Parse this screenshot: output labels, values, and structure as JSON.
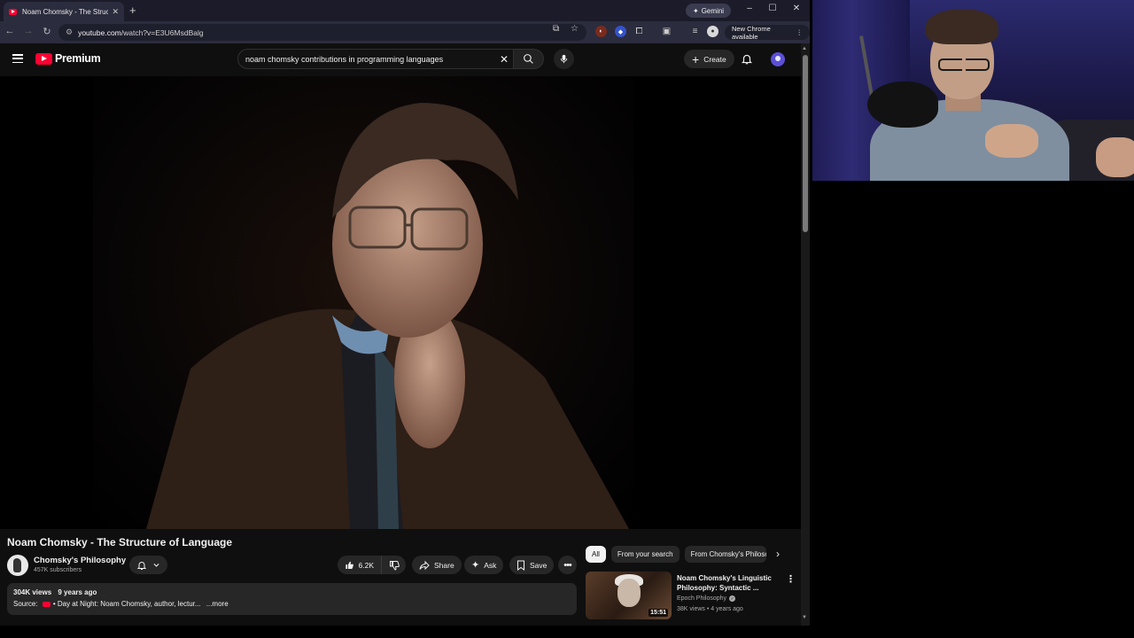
{
  "browser": {
    "tab": {
      "title": "Noam Chomsky - The Structure",
      "close": "✕"
    },
    "new_tab": "+",
    "gemini_label": "Gemini",
    "gemini_glyph": "✦",
    "window": {
      "minimize": "–",
      "maximize": "☐",
      "close": "✕"
    },
    "address": {
      "host": "youtube.com",
      "path": "/watch?v=E3U6MsdBalg"
    },
    "new_chrome_label": "New Chrome available",
    "kebab": "⋮"
  },
  "youtube": {
    "brand": "Premium",
    "search": {
      "query": "noam chomsky contributions in programming languages",
      "clear": "✕"
    },
    "create_label": "Create",
    "create_glyph": "+"
  },
  "video": {
    "title": "Noam Chomsky - The Structure of Language",
    "channel": "Chomsky's Philosophy",
    "subscribers": "457K subscribers",
    "likes": "6.2K",
    "share_label": "Share",
    "ask_label": "Ask",
    "save_label": "Save",
    "more_glyph": "•••",
    "views": "304K views",
    "age": "9 years ago",
    "source_prefix": "Source:",
    "source_text": "• Day at Night: Noam Chomsky, author, lectur...",
    "more_label": "...more"
  },
  "sidebar": {
    "chips": [
      "All",
      "From your search",
      "From Chomsky's Philosophy"
    ],
    "next_glyph": "›",
    "recommendations": [
      {
        "title": "Noam Chomsky's Linguistic Philosophy: Syntactic ...",
        "channel": "Epoch Philosophy",
        "views": "38K views",
        "age": "4 years ago",
        "duration": "15:51",
        "kebab": "⋮"
      }
    ]
  },
  "colors": {
    "accent_red": "#ff0033",
    "page_bg": "#0f0f0f",
    "pill_bg": "#272727"
  }
}
